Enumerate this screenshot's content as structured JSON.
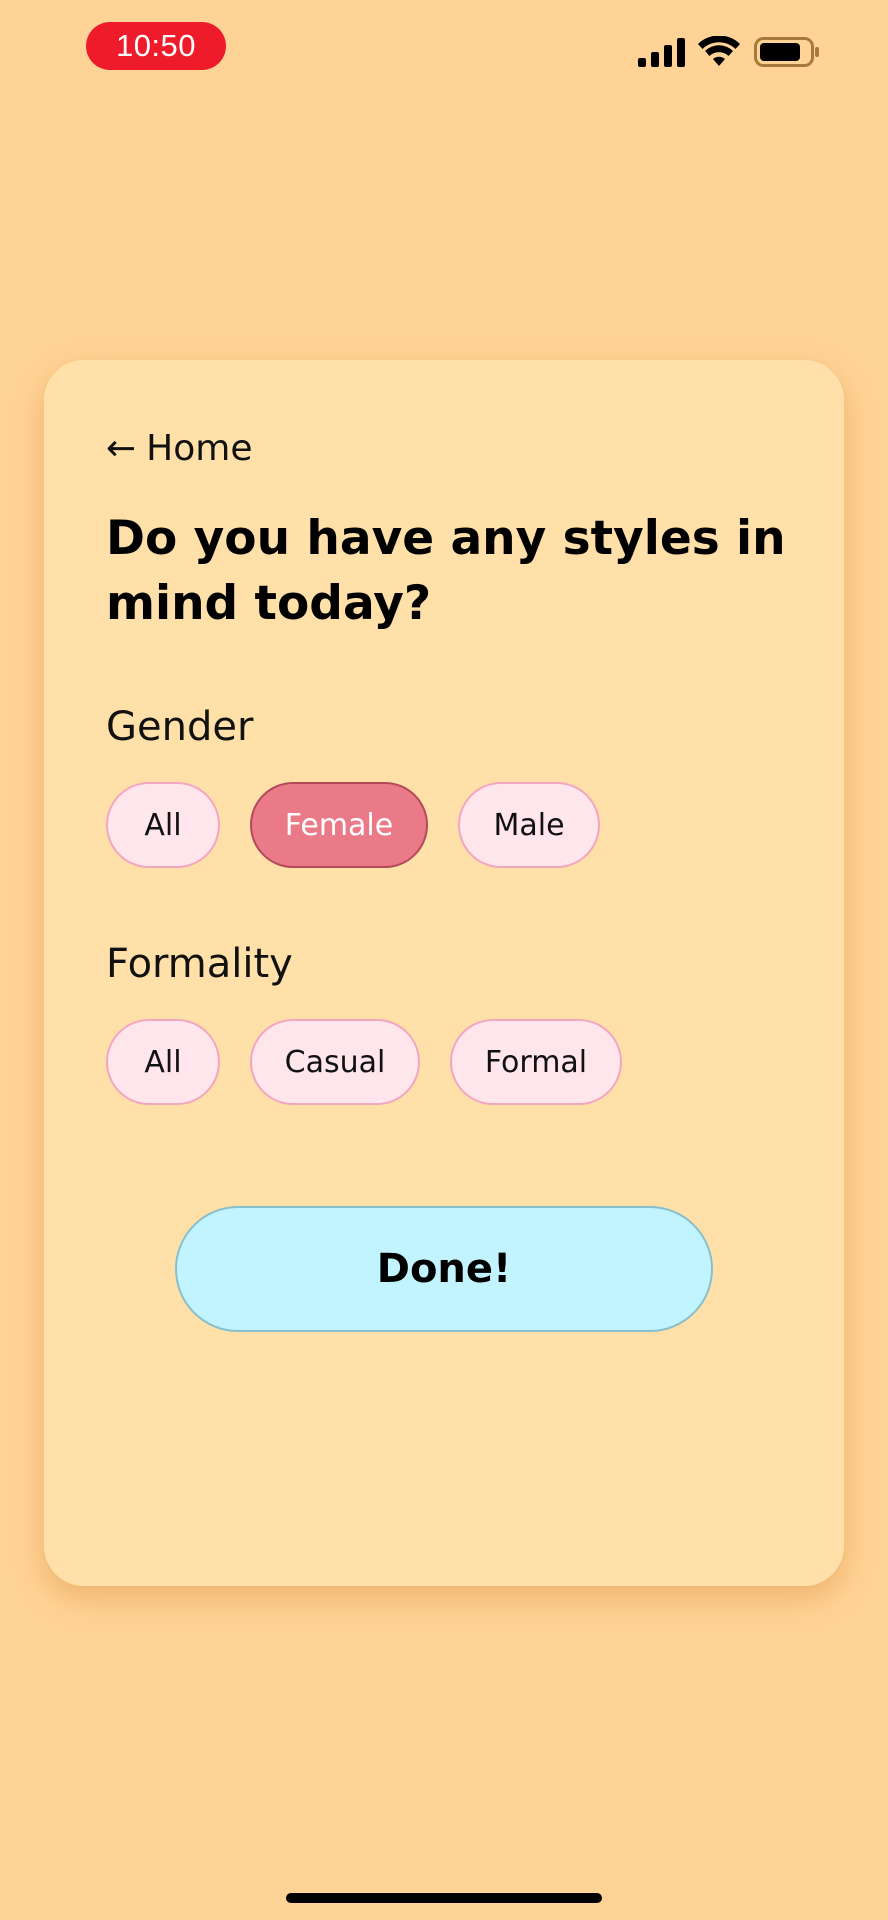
{
  "status_bar": {
    "time": "10:50",
    "icons": [
      "signal-icon",
      "wifi-icon",
      "battery-icon"
    ],
    "time_badge_color": "#EE1C2B"
  },
  "card": {
    "back_link_label": "Home",
    "back_icon": "left-arrow-icon",
    "question": "Do you have any styles in mind today?",
    "gender": {
      "label": "Gender",
      "options": [
        "All",
        "Female",
        "Male"
      ],
      "selected": "Female"
    },
    "formality": {
      "label": "Formality",
      "options": [
        "All",
        "Casual",
        "Formal"
      ],
      "selected": null
    },
    "done_label": "Done!"
  },
  "colors": {
    "background": "#FFD395",
    "card": "#FFE0A8",
    "chip": "#FFE5EC",
    "chip_border": "#F2A7C0",
    "chip_selected": "#EB7A89",
    "done_button": "#C1F4FF"
  }
}
